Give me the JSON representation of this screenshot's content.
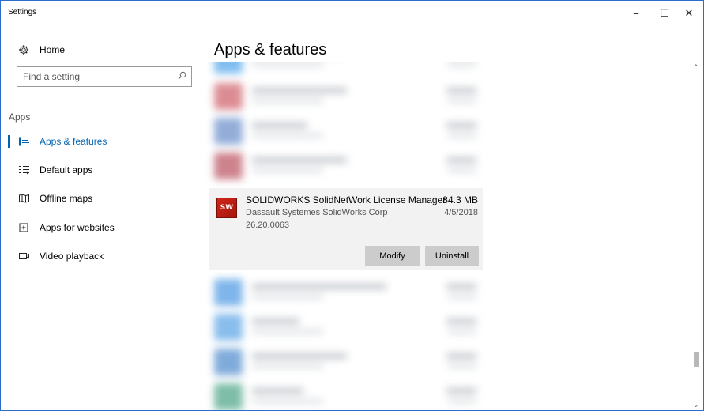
{
  "window": {
    "title": "Settings",
    "minimize_symbol": "−",
    "maximize_symbol": "☐",
    "close_symbol": "✕"
  },
  "sidebar": {
    "home_label": "Home",
    "search_placeholder": "Find a setting",
    "section_label": "Apps",
    "items": [
      {
        "label": "Apps & features",
        "icon": "list-icon",
        "active": true
      },
      {
        "label": "Default apps",
        "icon": "default-apps-icon",
        "active": false
      },
      {
        "label": "Offline maps",
        "icon": "map-icon",
        "active": false
      },
      {
        "label": "Apps for websites",
        "icon": "web-app-icon",
        "active": false
      },
      {
        "label": "Video playback",
        "icon": "video-icon",
        "active": false
      }
    ]
  },
  "main": {
    "title": "Apps & features",
    "selected_app": {
      "name": "SOLIDWORKS SolidNetWork License Manager",
      "publisher": "Dassault Systemes SolidWorks Corp",
      "version": "26.20.0063",
      "size": "84.3 MB",
      "date": "4/5/2018",
      "icon_text": "SW",
      "modify_label": "Modify",
      "uninstall_label": "Uninstall"
    }
  },
  "colors": {
    "accent": "#0063b1",
    "window_border": "#2b6ec8",
    "selected_bg": "#f2f2f2",
    "button_bg": "#cccccc"
  }
}
